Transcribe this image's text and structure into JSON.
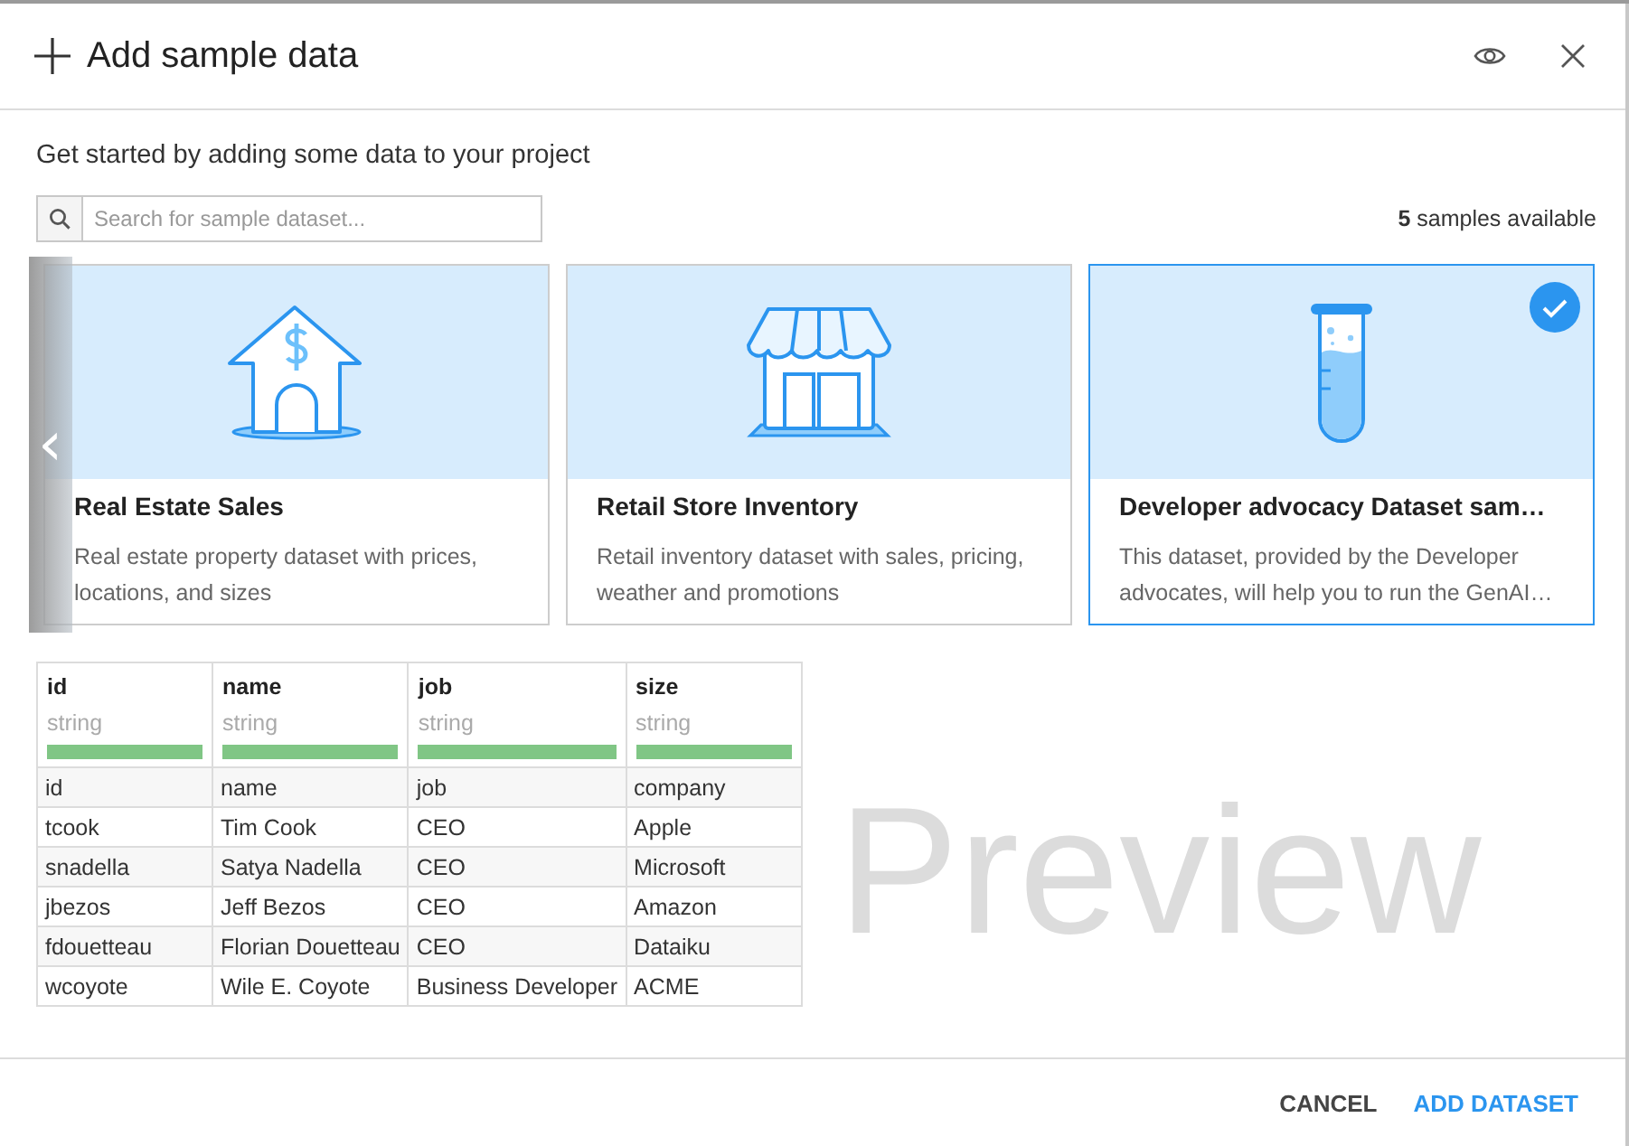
{
  "dialog": {
    "title": "Add sample data"
  },
  "intro": "Get started by adding some data to your project",
  "search": {
    "placeholder": "Search for sample dataset..."
  },
  "sample_count": {
    "count": "5",
    "label": "samples available"
  },
  "samples": [
    {
      "kind": "house",
      "title": "Real Estate Sales",
      "description": "Real estate property dataset with prices, locations, and sizes",
      "selected": false
    },
    {
      "kind": "store",
      "title": "Retail Store Inventory",
      "description": "Retail inventory dataset with sales, pricing, weather and promotions",
      "selected": false
    },
    {
      "kind": "tube",
      "title": "Developer advocacy Dataset sam…",
      "description": "This dataset, provided by the Developer advocates, will help you to run the GenAI…",
      "selected": true
    }
  ],
  "carousel": {
    "previous": "‹"
  },
  "preview": {
    "label": "Preview",
    "columns": [
      {
        "name": "id",
        "type": "string"
      },
      {
        "name": "name",
        "type": "string"
      },
      {
        "name": "job",
        "type": "string"
      },
      {
        "name": "size",
        "type": "string"
      }
    ],
    "rows": [
      [
        "id",
        "name",
        "job",
        "company"
      ],
      [
        "tcook",
        "Tim Cook",
        "CEO",
        "Apple"
      ],
      [
        "snadella",
        "Satya Nadella",
        "CEO",
        "Microsoft"
      ],
      [
        "jbezos",
        "Jeff Bezos",
        "CEO",
        "Amazon"
      ],
      [
        "fdouetteau",
        "Florian Douetteau",
        "CEO",
        "Dataiku"
      ],
      [
        "wcoyote",
        "Wile E. Coyote",
        "Business Developer",
        "ACME"
      ]
    ]
  },
  "buttons": [
    "CANCEL",
    "ADD DATASET"
  ]
}
